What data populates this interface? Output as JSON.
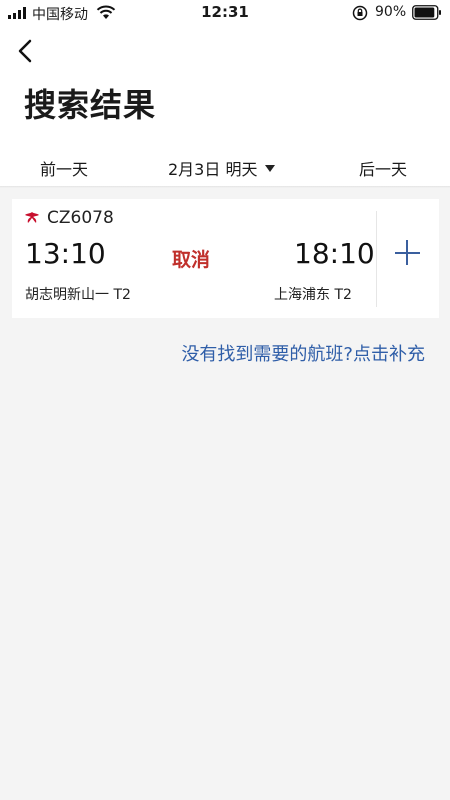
{
  "status_bar": {
    "carrier": "中国移动",
    "time": "12:31",
    "battery": "90%",
    "battery_level": 0.9
  },
  "header": {
    "title": "搜索结果"
  },
  "date_bar": {
    "prev_label": "前一天",
    "current_date": "2月3日 明天",
    "next_label": "后一天"
  },
  "flight": {
    "flight_number": "CZ6078",
    "departure_time": "13:10",
    "status": "取消",
    "arrival_time": "18:10",
    "departure_airport": "胡志明新山一 T2",
    "arrival_airport": "上海浦东 T2",
    "status_color": "#c0302b"
  },
  "footer": {
    "supplement_link": "没有找到需要的航班?点击补充"
  },
  "colors": {
    "accent": "#2f5ea8",
    "cancel": "#c0302b"
  },
  "icons": [
    "signal-icon",
    "wifi-icon",
    "orientation-lock-icon",
    "battery-icon",
    "back-arrow-icon",
    "dropdown-caret-icon",
    "airline-logo-icon",
    "add-icon"
  ]
}
